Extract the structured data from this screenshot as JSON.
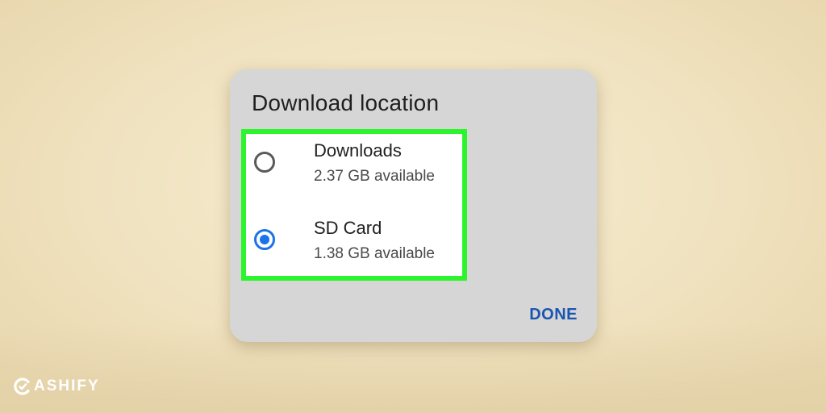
{
  "dialog": {
    "title": "Download location",
    "options": [
      {
        "label": "Downloads",
        "detail": "2.37 GB available",
        "selected": false
      },
      {
        "label": "SD Card",
        "detail": "1.38 GB available",
        "selected": true
      }
    ],
    "done_label": "DONE"
  },
  "watermark": {
    "text": "ASHIFY"
  },
  "colors": {
    "highlight_border": "#2df52d",
    "accent": "#1a73e8",
    "done_text": "#1a56b0",
    "dialog_bg": "#d6d6d6"
  },
  "icons": {
    "logo": "cashify-c-logo-icon"
  }
}
